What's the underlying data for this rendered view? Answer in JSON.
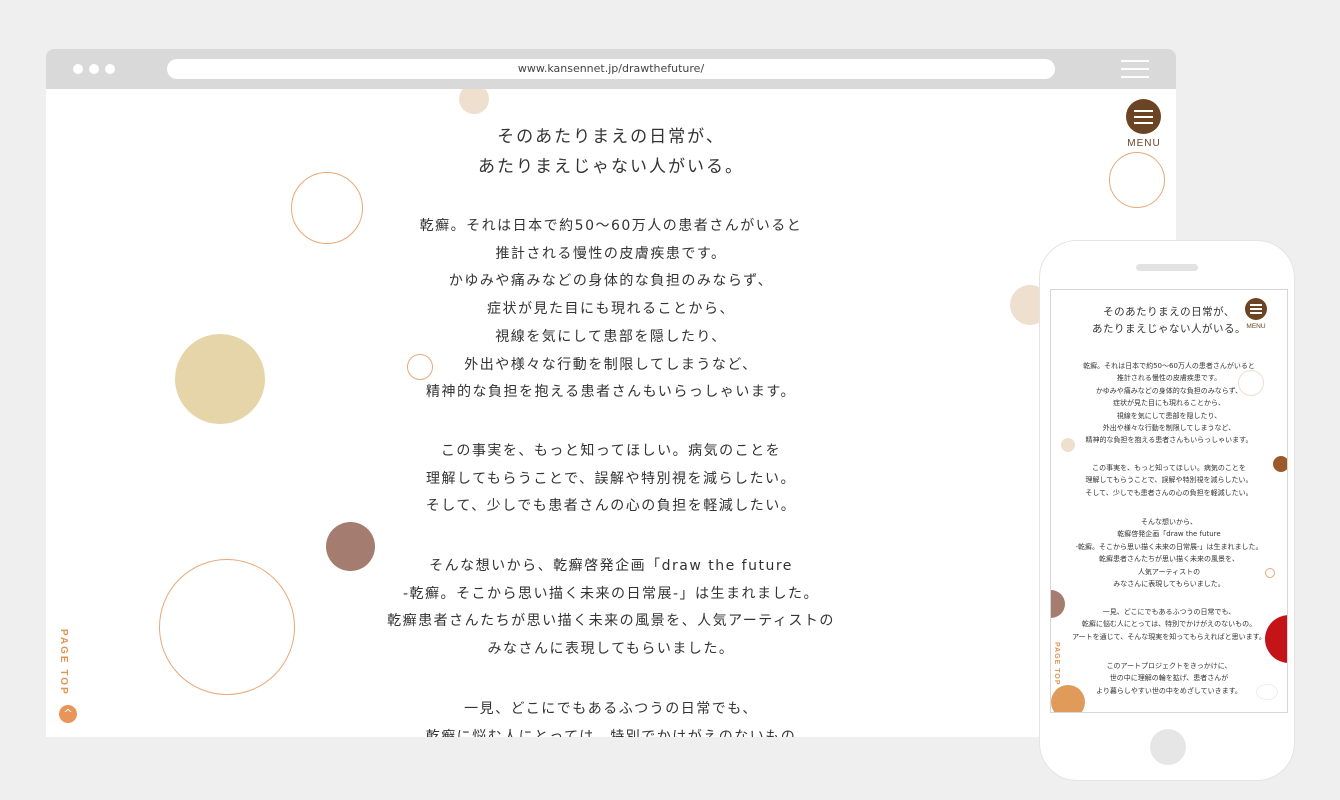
{
  "browser": {
    "url": "www.kansennet.jp/drawthefuture/"
  },
  "page": {
    "heading": [
      "そのあたりまえの日常が、",
      "あたりまえじゃない人がいる。"
    ],
    "paragraphs": [
      [
        "乾癬。それは日本で約50〜60万人の患者さんがいると",
        "推計される慢性の皮膚疾患です。",
        "かゆみや痛みなどの身体的な負担のみならず、",
        "症状が見た目にも現れることから、",
        "視線を気にして患部を隠したり、",
        "外出や様々な行動を制限してしまうなど、",
        "精神的な負担を抱える患者さんもいらっしゃいます。"
      ],
      [
        "この事実を、もっと知ってほしい。病気のことを",
        "理解してもらうことで、誤解や特別視を減らしたい。",
        "そして、少しでも患者さんの心の負担を軽減したい。"
      ],
      [
        "そんな想いから、乾癬啓発企画「draw the future",
        "-乾癬。そこから思い描く未来の日常展-」は生まれました。",
        "乾癬患者さんたちが思い描く未来の風景を、人気アーティストの",
        "みなさんに表現してもらいました。"
      ],
      [
        "一見、どこにでもあるふつうの日常でも、",
        "乾癬に悩む人にとっては、特別でかけがえのないもの"
      ]
    ],
    "menu_label": "MENU",
    "page_top_label": "PAGE TOP",
    "page_top_arrow": "^"
  },
  "mobile": {
    "heading": [
      "そのあたりまえの日常が、",
      "あたりまえじゃない人がいる。"
    ],
    "paragraphs": [
      [
        "乾癬。それは日本で約50〜60万人の患者さんがいると",
        "推計される慢性の皮膚疾患です。",
        "かゆみや痛みなどの身体的な負担のみならず、",
        "症状が見た目にも現れることから、",
        "視線を気にして患部を隠したり、",
        "外出や様々な行動を制限してしまうなど、",
        "精神的な負担を抱える患者さんもいらっしゃいます。"
      ],
      [
        "この事実を、もっと知ってほしい。病気のことを",
        "理解してもらうことで、誤解や特別視を減らしたい。",
        "そして、少しでも患者さんの心の負担を軽減したい。"
      ],
      [
        "そんな想いから、",
        "乾癬啓発企画「draw the future",
        "-乾癬。そこから思い描く未来の日常展-」は生まれました。",
        "乾癬患者さんたちが思い描く未来の風景を、",
        "人気アーティストの",
        "みなさんに表現してもらいました。"
      ],
      [
        "一見、どこにでもあるふつうの日常でも、",
        "乾癬に悩む人にとっては、特別でかけがえのないもの。",
        "アートを通じて、そんな現実を知ってもらえればと思います。"
      ],
      [
        "このアートプロジェクトをきっかけに、",
        "世の中に理解の輪を拡げ、患者さんが",
        "より暮らしやすい世の中をめざしていきます。"
      ]
    ],
    "menu_label": "MENU",
    "page_top_label": "PAGE TOP"
  },
  "colors": {
    "menu_brown": "#6b4424",
    "accent_orange": "#e29453",
    "beige": "#e6d5a8",
    "mauve": "#a57c70",
    "outline_orange": "#e8a878",
    "pale_peach": "#eedfcf",
    "red": "#c41418"
  }
}
